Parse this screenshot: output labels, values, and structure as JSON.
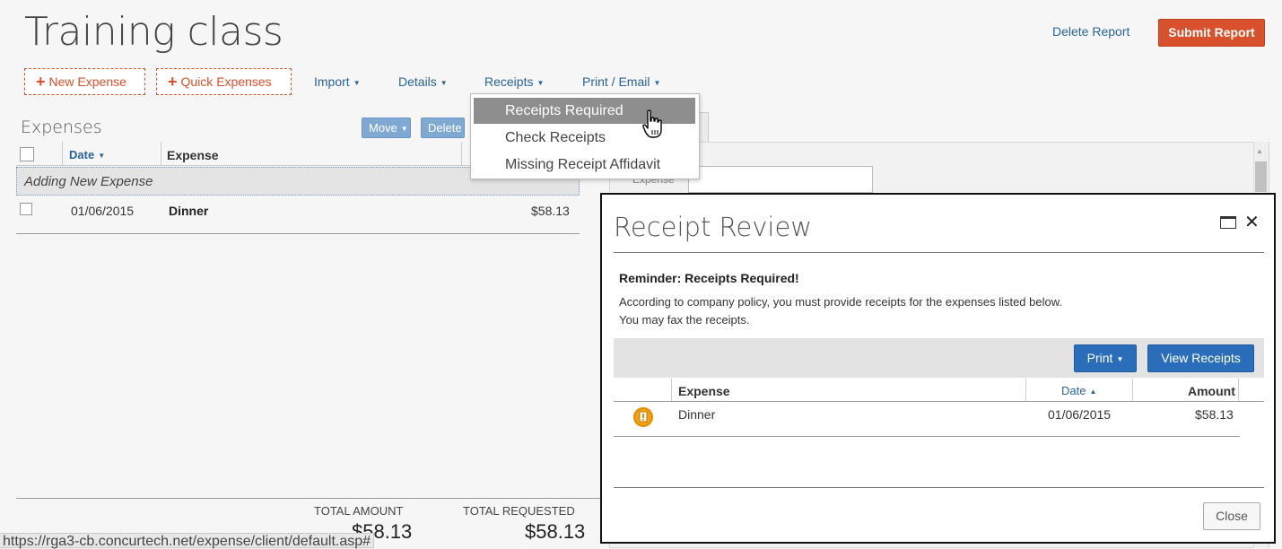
{
  "header": {
    "title": "Training class",
    "delete_report": "Delete Report",
    "submit_report": "Submit Report"
  },
  "toolbar": {
    "new_expense": "New Expense",
    "quick_expenses": "Quick Expenses",
    "menus": [
      "Import",
      "Details",
      "Receipts",
      "Print / Email"
    ]
  },
  "receipts_menu": {
    "items": [
      "Receipts Required",
      "Check Receipts",
      "Missing Receipt Affidavit"
    ],
    "highlighted": "Receipts Required"
  },
  "expenses": {
    "title": "Expenses",
    "move_label": "Move",
    "delete_label": "Delete",
    "columns": {
      "date": "Date",
      "expense": "Expense"
    },
    "adding_label": "Adding New Expense",
    "rows": [
      {
        "date": "01/06/2015",
        "expense": "Dinner",
        "amount": "$58.13"
      }
    ],
    "totals": {
      "amount_label": "TOTAL AMOUNT",
      "amount_value": "$58.13",
      "requested_label": "TOTAL REQUESTED",
      "requested_value": "$58.13"
    }
  },
  "right_panel": {
    "field_label": "Expense"
  },
  "modal": {
    "title": "Receipt Review",
    "reminder": "Reminder: Receipts Required!",
    "policy_text": "According to company policy, you must provide receipts for the expenses listed below.",
    "fax_text": "You may fax the receipts.",
    "print_label": "Print",
    "view_receipts_label": "View Receipts",
    "columns": {
      "expense": "Expense",
      "date": "Date",
      "amount": "Amount"
    },
    "rows": [
      {
        "expense": "Dinner",
        "date": "01/06/2015",
        "amount": "$58.13"
      }
    ],
    "close_label": "Close"
  },
  "status_bar": {
    "url": "https://rga3-cb.concurtech.net/expense/client/default.asp#"
  },
  "colors": {
    "accent": "#d9512c",
    "link": "#2a6496",
    "primary_button": "#2a6ebb",
    "warning_icon": "#f2a30f"
  }
}
